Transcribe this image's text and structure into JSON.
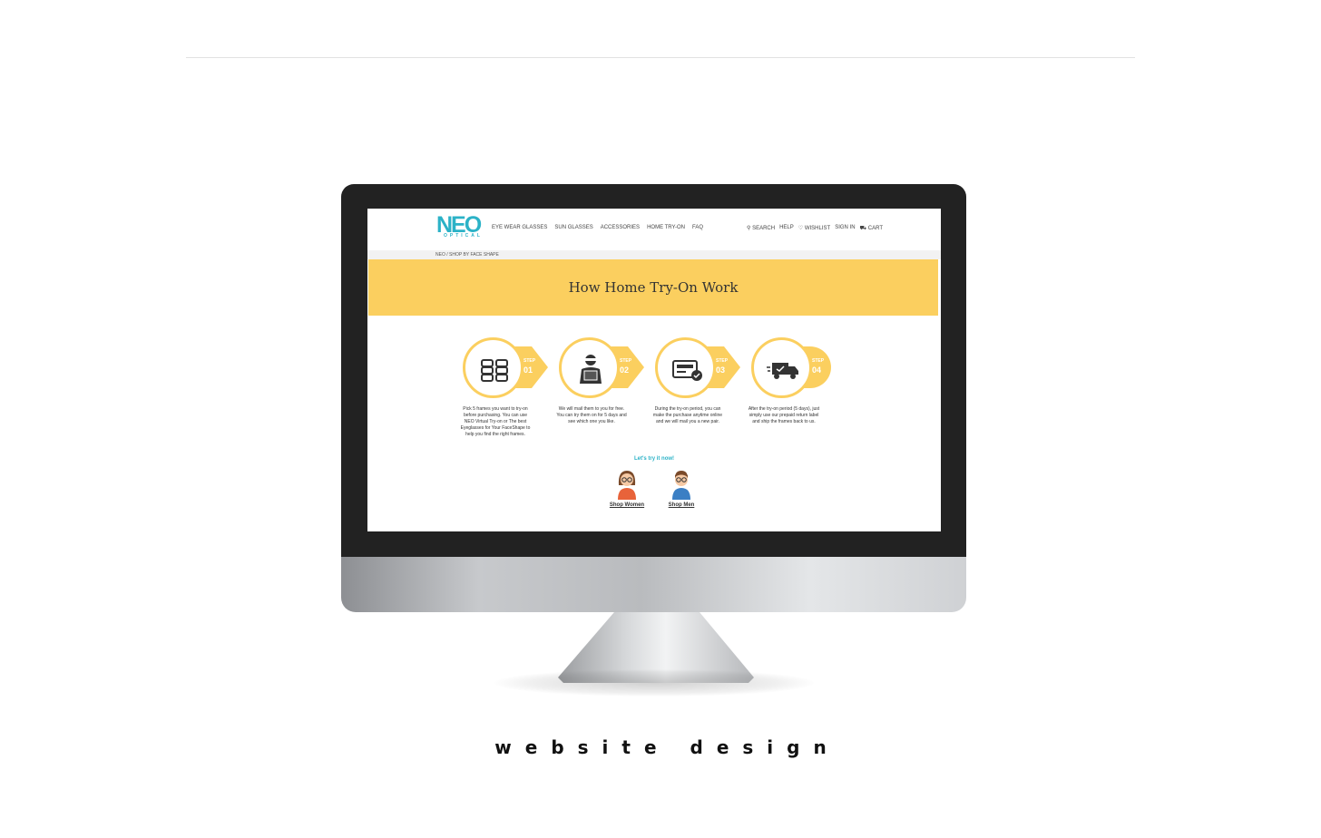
{
  "caption": "website design",
  "site": {
    "logo": "NEO",
    "logo_sub": "OPTICAL",
    "nav": [
      "EYE WEAR GLASSES",
      "SUN GLASSES",
      "ACCESSORIES",
      "HOME TRY-ON",
      "FAQ"
    ],
    "nav_right": [
      "SEARCH",
      "HELP",
      "WISHLIST",
      "SIGN IN",
      "CART"
    ],
    "breadcrumb": "NEO / SHOP BY FACE SHAPE",
    "banner_title": "How Home Try-On Work",
    "step_label": "STEP",
    "steps": [
      {
        "num": "01",
        "icon": "glasses-stack-icon",
        "desc": "Pick 5 frames you want to try-on before purchasing. You can use NEO Virtual Try-on or The best Eyeglasses for Your FaceShape to help you find the right frames."
      },
      {
        "num": "02",
        "icon": "delivery-person-box-icon",
        "desc": "We will mail them to you for free. You can try them on for 5 days and see which one you like."
      },
      {
        "num": "03",
        "icon": "online-purchase-card-icon",
        "desc": "During the try-on period, you can make the purchase anytime online and we will mail you a new pair."
      },
      {
        "num": "04",
        "icon": "delivery-truck-icon",
        "desc": "After the try-on period (5 days), just simply use our prepaid return label and ship the frames back to us."
      }
    ],
    "cta": "Let's try it now!",
    "shop_women": "Shop Women",
    "shop_men": "Shop Men"
  },
  "colors": {
    "accent_yellow": "#fbcf5f",
    "brand_teal": "#2bb2c7",
    "bezel": "#222222"
  }
}
